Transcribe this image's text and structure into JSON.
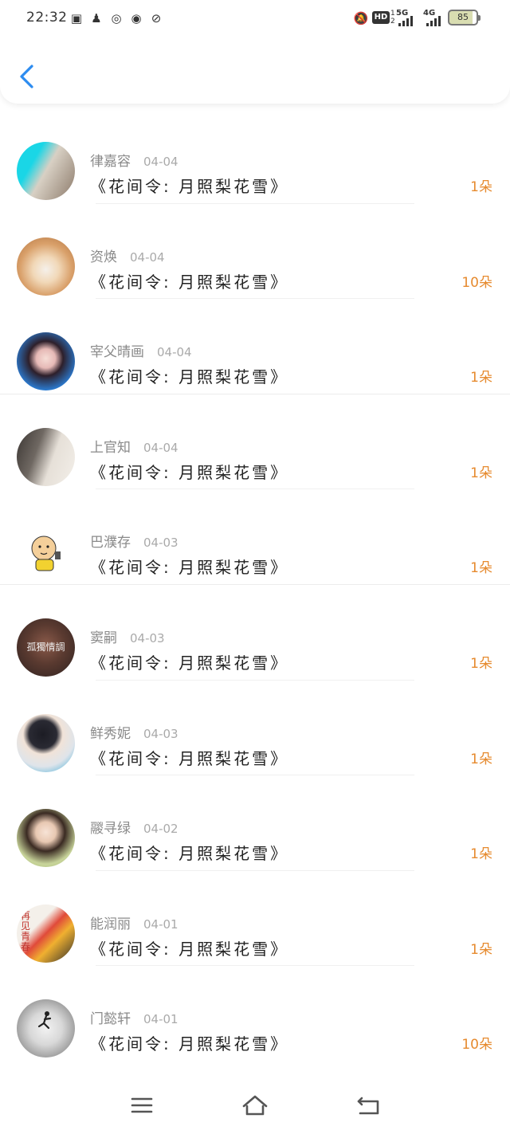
{
  "status_bar": {
    "time": "22:32",
    "hd": "HD",
    "hd_sub_top": "1",
    "hd_sub_bottom": "2",
    "net1": "5G",
    "net2": "4G",
    "battery": "85"
  },
  "header": {
    "back_icon": "chevron-left-icon"
  },
  "rows": [
    {
      "name": "律嘉容",
      "date": "04-04",
      "title": "《花间令: 月照梨花雪》",
      "amount": "1朵"
    },
    {
      "name": "资焕",
      "date": "04-04",
      "title": "《花间令: 月照梨花雪》",
      "amount": "10朵"
    },
    {
      "name": "宰父晴画",
      "date": "04-04",
      "title": "《花间令: 月照梨花雪》",
      "amount": "1朵"
    },
    {
      "name": "上官知",
      "date": "04-04",
      "title": "《花间令: 月照梨花雪》",
      "amount": "1朵"
    },
    {
      "name": "巴濮存",
      "date": "04-03",
      "title": "《花间令: 月照梨花雪》",
      "amount": "1朵"
    },
    {
      "name": "窦嗣",
      "date": "04-03",
      "title": "《花间令: 月照梨花雪》",
      "amount": "1朵"
    },
    {
      "name": "鲜秀妮",
      "date": "04-03",
      "title": "《花间令: 月照梨花雪》",
      "amount": "1朵"
    },
    {
      "name": "鬷寻绿",
      "date": "04-02",
      "title": "《花间令: 月照梨花雪》",
      "amount": "1朵"
    },
    {
      "name": "能润丽",
      "date": "04-01",
      "title": "《花间令: 月照梨花雪》",
      "amount": "1朵"
    },
    {
      "name": "门懿轩",
      "date": "04-01",
      "title": "《花间令: 月照梨花雪》",
      "amount": "10朵"
    }
  ],
  "avatar_text": {
    "row5": "孤獨情調",
    "row8": "再见青春"
  },
  "colors": {
    "accent": "#2d8cf0",
    "amount": "#e68a2e"
  },
  "nav": {
    "menu_icon": "menu-icon",
    "home_icon": "home-icon",
    "back_icon": "back-icon"
  }
}
